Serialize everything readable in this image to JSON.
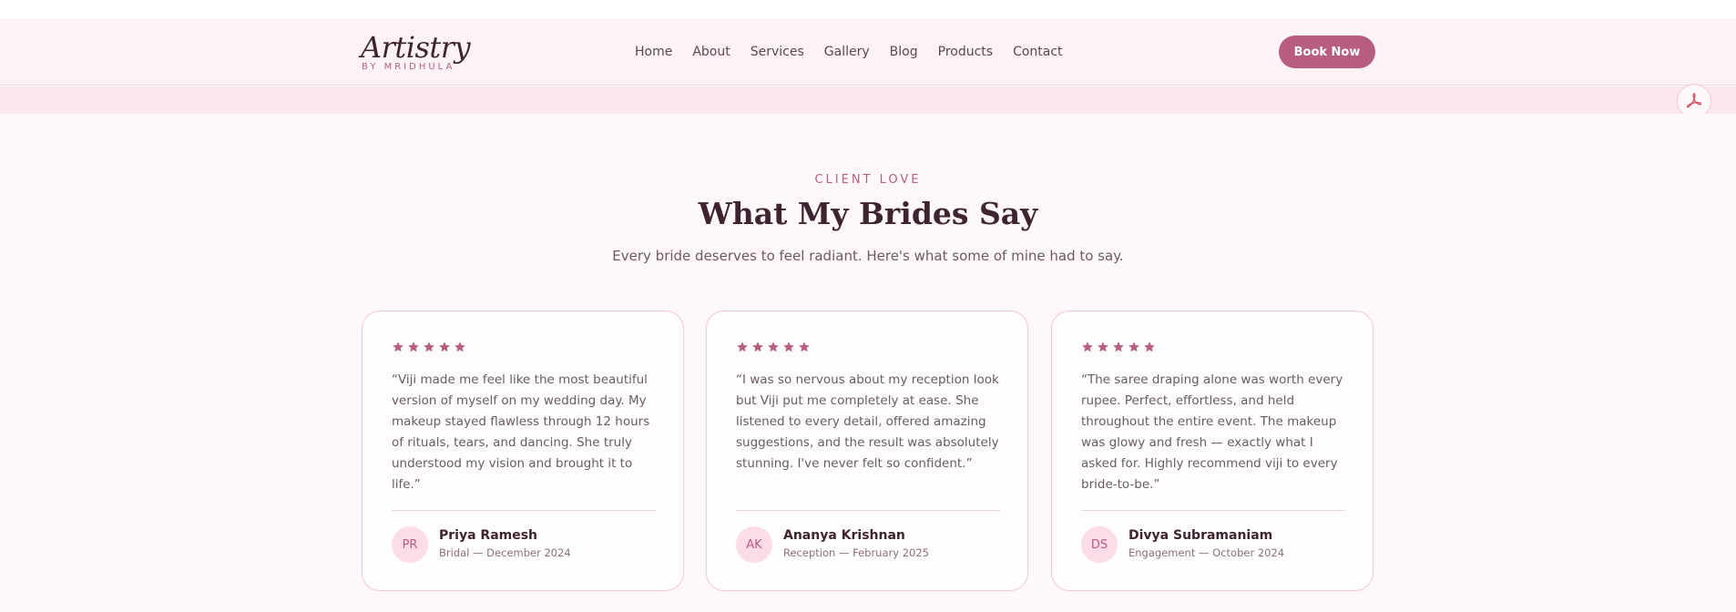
{
  "brand": {
    "name": "Artistry",
    "tagline": "BY MRIDHULA",
    "accent_color": "#b75d82",
    "text_color": "#3d2430"
  },
  "nav": {
    "items": [
      {
        "label": "Home"
      },
      {
        "label": "About"
      },
      {
        "label": "Services"
      },
      {
        "label": "Gallery"
      },
      {
        "label": "Blog"
      },
      {
        "label": "Products"
      },
      {
        "label": "Contact"
      }
    ],
    "cta_label": "Book Now"
  },
  "floating": {
    "pdf_icon": "acrobat-pdf-icon",
    "side_icon": "brain-icon"
  },
  "testimonials": {
    "eyebrow": "CLIENT LOVE",
    "title": "What My Brides Say",
    "subtitle": "Every bride deserves to feel radiant. Here's what some of mine had to say.",
    "cards": [
      {
        "rating": 5,
        "quote": "“Viji made me feel like the most beautiful version of myself on my wedding day. My makeup stayed flawless through 12 hours of rituals, tears, and dancing. She truly understood my vision and brought it to life.”",
        "initials": "PR",
        "name": "Priya Ramesh",
        "meta": "Bridal — December 2024"
      },
      {
        "rating": 5,
        "quote": "“I was so nervous about my reception look but Viji put me completely at ease. She listened to every detail, offered amazing suggestions, and the result was absolutely stunning. I've never felt so confident.”",
        "initials": "AK",
        "name": "Ananya Krishnan",
        "meta": "Reception — February 2025"
      },
      {
        "rating": 5,
        "quote": "“The saree draping alone was worth every rupee. Perfect, effortless, and held throughout the entire event. The makeup was glowy and fresh — exactly what I asked for. Highly recommend viji to every bride-to-be.”",
        "initials": "DS",
        "name": "Divya Subramaniam",
        "meta": "Engagement — October 2024"
      }
    ]
  }
}
